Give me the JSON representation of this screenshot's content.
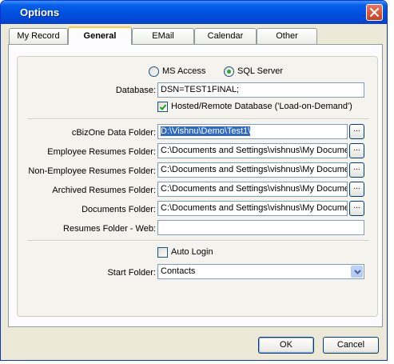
{
  "window": {
    "title": "Options"
  },
  "tabs": [
    {
      "label": "My Record"
    },
    {
      "label": "General"
    },
    {
      "label": "EMail"
    },
    {
      "label": "Calendar"
    },
    {
      "label": "Other"
    }
  ],
  "active_tab": "General",
  "database_type": {
    "options": [
      {
        "label": "MS Access",
        "selected": false
      },
      {
        "label": "SQL Server",
        "selected": true
      }
    ]
  },
  "database": {
    "label": "Database:",
    "value": "DSN=TEST1FINAL;"
  },
  "hosted": {
    "label": "Hosted/Remote Database ('Load-on-Demand')",
    "checked": true
  },
  "folders": [
    {
      "label": "cBizOne Data Folder:",
      "value": "D:\\Vishnu\\Demo\\Test1\\",
      "selected": true,
      "browse": "..."
    },
    {
      "label": "Employee Resumes Folder:",
      "value": "C:\\Documents and Settings\\vishnus\\My Documents",
      "browse": "..."
    },
    {
      "label": "Non-Employee Resumes Folder:",
      "value": "C:\\Documents and Settings\\vishnus\\My Documents",
      "browse": "..."
    },
    {
      "label": "Archived Resumes Folder:",
      "value": "C:\\Documents and Settings\\vishnus\\My Documents",
      "browse": "..."
    },
    {
      "label": "Documents Folder:",
      "value": "C:\\Documents and Settings\\vishnus\\My Documents",
      "browse": "..."
    }
  ],
  "resumes_web": {
    "label": "Resumes Folder - Web:",
    "value": ""
  },
  "auto_login": {
    "label": "Auto Login",
    "checked": false
  },
  "start_folder": {
    "label": "Start Folder:",
    "value": "Contacts"
  },
  "buttons": {
    "ok": "OK",
    "cancel": "Cancel"
  },
  "colors": {
    "title_bar": "#0054E3",
    "face": "#ECE9D8",
    "selection": "#316AC5",
    "radio_dot": "#2FA62F",
    "check_mark": "#21A121"
  },
  "icons": {
    "close": "close-icon",
    "dropdown": "chevron-down-icon",
    "check": "check-icon"
  }
}
